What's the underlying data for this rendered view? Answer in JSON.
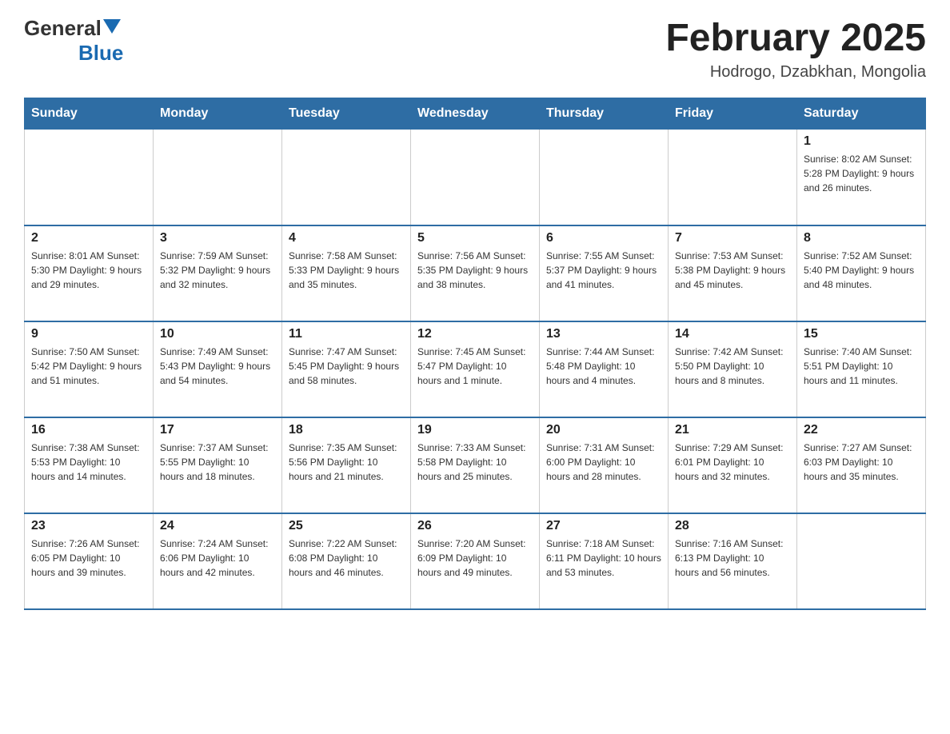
{
  "header": {
    "logo": {
      "general": "General",
      "blue": "Blue",
      "tagline": ""
    },
    "title": "February 2025",
    "location": "Hodrogo, Dzabkhan, Mongolia"
  },
  "weekdays": [
    "Sunday",
    "Monday",
    "Tuesday",
    "Wednesday",
    "Thursday",
    "Friday",
    "Saturday"
  ],
  "weeks": [
    [
      {
        "day": "",
        "info": ""
      },
      {
        "day": "",
        "info": ""
      },
      {
        "day": "",
        "info": ""
      },
      {
        "day": "",
        "info": ""
      },
      {
        "day": "",
        "info": ""
      },
      {
        "day": "",
        "info": ""
      },
      {
        "day": "1",
        "info": "Sunrise: 8:02 AM\nSunset: 5:28 PM\nDaylight: 9 hours and 26 minutes."
      }
    ],
    [
      {
        "day": "2",
        "info": "Sunrise: 8:01 AM\nSunset: 5:30 PM\nDaylight: 9 hours and 29 minutes."
      },
      {
        "day": "3",
        "info": "Sunrise: 7:59 AM\nSunset: 5:32 PM\nDaylight: 9 hours and 32 minutes."
      },
      {
        "day": "4",
        "info": "Sunrise: 7:58 AM\nSunset: 5:33 PM\nDaylight: 9 hours and 35 minutes."
      },
      {
        "day": "5",
        "info": "Sunrise: 7:56 AM\nSunset: 5:35 PM\nDaylight: 9 hours and 38 minutes."
      },
      {
        "day": "6",
        "info": "Sunrise: 7:55 AM\nSunset: 5:37 PM\nDaylight: 9 hours and 41 minutes."
      },
      {
        "day": "7",
        "info": "Sunrise: 7:53 AM\nSunset: 5:38 PM\nDaylight: 9 hours and 45 minutes."
      },
      {
        "day": "8",
        "info": "Sunrise: 7:52 AM\nSunset: 5:40 PM\nDaylight: 9 hours and 48 minutes."
      }
    ],
    [
      {
        "day": "9",
        "info": "Sunrise: 7:50 AM\nSunset: 5:42 PM\nDaylight: 9 hours and 51 minutes."
      },
      {
        "day": "10",
        "info": "Sunrise: 7:49 AM\nSunset: 5:43 PM\nDaylight: 9 hours and 54 minutes."
      },
      {
        "day": "11",
        "info": "Sunrise: 7:47 AM\nSunset: 5:45 PM\nDaylight: 9 hours and 58 minutes."
      },
      {
        "day": "12",
        "info": "Sunrise: 7:45 AM\nSunset: 5:47 PM\nDaylight: 10 hours and 1 minute."
      },
      {
        "day": "13",
        "info": "Sunrise: 7:44 AM\nSunset: 5:48 PM\nDaylight: 10 hours and 4 minutes."
      },
      {
        "day": "14",
        "info": "Sunrise: 7:42 AM\nSunset: 5:50 PM\nDaylight: 10 hours and 8 minutes."
      },
      {
        "day": "15",
        "info": "Sunrise: 7:40 AM\nSunset: 5:51 PM\nDaylight: 10 hours and 11 minutes."
      }
    ],
    [
      {
        "day": "16",
        "info": "Sunrise: 7:38 AM\nSunset: 5:53 PM\nDaylight: 10 hours and 14 minutes."
      },
      {
        "day": "17",
        "info": "Sunrise: 7:37 AM\nSunset: 5:55 PM\nDaylight: 10 hours and 18 minutes."
      },
      {
        "day": "18",
        "info": "Sunrise: 7:35 AM\nSunset: 5:56 PM\nDaylight: 10 hours and 21 minutes."
      },
      {
        "day": "19",
        "info": "Sunrise: 7:33 AM\nSunset: 5:58 PM\nDaylight: 10 hours and 25 minutes."
      },
      {
        "day": "20",
        "info": "Sunrise: 7:31 AM\nSunset: 6:00 PM\nDaylight: 10 hours and 28 minutes."
      },
      {
        "day": "21",
        "info": "Sunrise: 7:29 AM\nSunset: 6:01 PM\nDaylight: 10 hours and 32 minutes."
      },
      {
        "day": "22",
        "info": "Sunrise: 7:27 AM\nSunset: 6:03 PM\nDaylight: 10 hours and 35 minutes."
      }
    ],
    [
      {
        "day": "23",
        "info": "Sunrise: 7:26 AM\nSunset: 6:05 PM\nDaylight: 10 hours and 39 minutes."
      },
      {
        "day": "24",
        "info": "Sunrise: 7:24 AM\nSunset: 6:06 PM\nDaylight: 10 hours and 42 minutes."
      },
      {
        "day": "25",
        "info": "Sunrise: 7:22 AM\nSunset: 6:08 PM\nDaylight: 10 hours and 46 minutes."
      },
      {
        "day": "26",
        "info": "Sunrise: 7:20 AM\nSunset: 6:09 PM\nDaylight: 10 hours and 49 minutes."
      },
      {
        "day": "27",
        "info": "Sunrise: 7:18 AM\nSunset: 6:11 PM\nDaylight: 10 hours and 53 minutes."
      },
      {
        "day": "28",
        "info": "Sunrise: 7:16 AM\nSunset: 6:13 PM\nDaylight: 10 hours and 56 minutes."
      },
      {
        "day": "",
        "info": ""
      }
    ]
  ]
}
